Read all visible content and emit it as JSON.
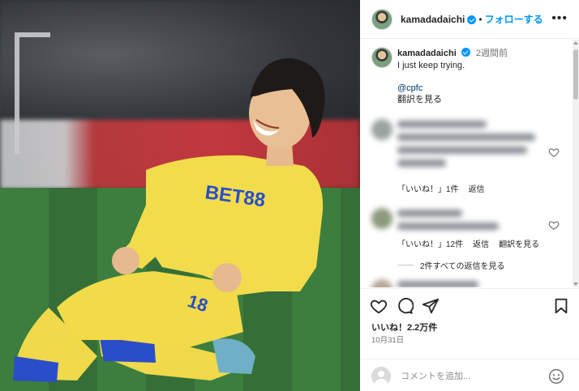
{
  "post": {
    "author": "kamadadaichi",
    "follow_label": "フォローする",
    "separator": "•",
    "more_label": "•••"
  },
  "caption": {
    "author": "kamadadaichi",
    "time": "2週間前",
    "text": "I just keep trying.",
    "mention": "@cpfc",
    "translate": "翻訳を見る"
  },
  "comments": [
    {
      "likes_label": "「いいね！」1件",
      "reply_label": "返信"
    },
    {
      "likes_label": "「いいね！」12件",
      "reply_label": "返信",
      "translate_label": "翻訳を見る"
    }
  ],
  "view_replies": "2件すべての返信を見る",
  "engagement": {
    "likes": "いいね！2.2万件",
    "date": "10月31日"
  },
  "add_comment": {
    "placeholder": "コメントを追加..."
  },
  "photo": {
    "jersey_text": "BET88",
    "shirt_number": "18"
  },
  "colors": {
    "accent": "#0095f6",
    "link": "#00376b",
    "kit_yellow": "#f3dc4c",
    "kit_blue": "#2a4ec9"
  }
}
